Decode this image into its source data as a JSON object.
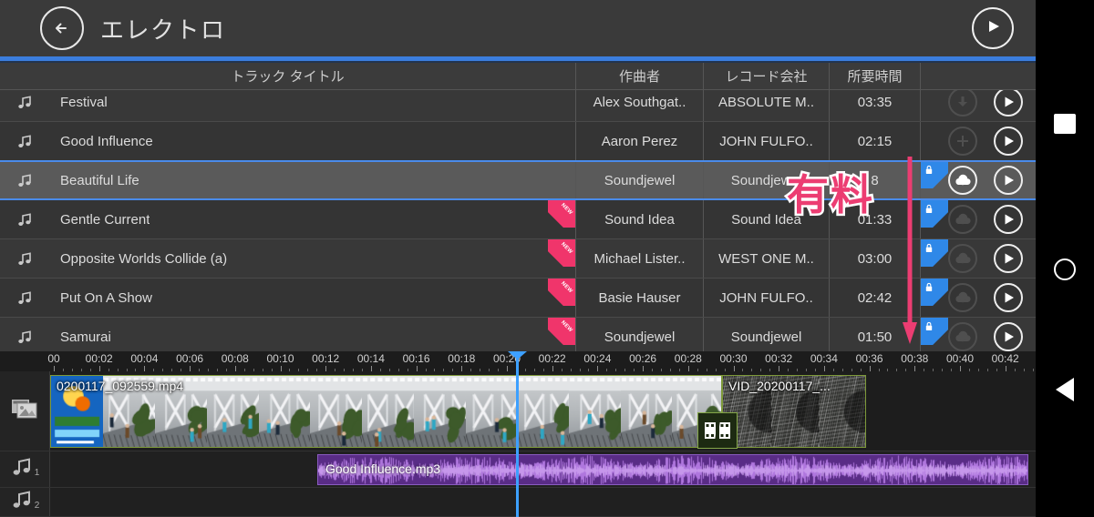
{
  "app": {
    "title": "エレクトロ",
    "back_icon": "back-arrow-icon",
    "play_icon": "play-icon"
  },
  "table": {
    "headers": {
      "track_title": "トラック タイトル",
      "composer": "作曲者",
      "label": "レコード会社",
      "duration": "所要時間",
      "actions": ""
    },
    "rows": [
      {
        "title": "Festival",
        "composer": "Alex Southgat..",
        "label": "ABSOLUTE M..",
        "duration": "03:35",
        "new": false,
        "locked": false,
        "selected": false,
        "action": "download-icon"
      },
      {
        "title": "Good Influence",
        "composer": "Aaron Perez",
        "label": "JOHN FULFO..",
        "duration": "02:15",
        "new": false,
        "locked": false,
        "selected": false,
        "action": "plus-icon"
      },
      {
        "title": "Beautiful Life",
        "composer": "Soundjewel",
        "label": "Soundjewel",
        "duration": "8",
        "new": false,
        "locked": true,
        "selected": true,
        "action": "cloud-download-icon"
      },
      {
        "title": "Gentle Current",
        "composer": "Sound Idea",
        "label": "Sound Idea",
        "duration": "01:33",
        "new": true,
        "locked": true,
        "selected": false,
        "action": "cloud-download-icon"
      },
      {
        "title": "Opposite Worlds Collide (a)",
        "composer": "Michael Lister..",
        "label": "WEST ONE M..",
        "duration": "03:00",
        "new": true,
        "locked": true,
        "selected": false,
        "action": "cloud-download-icon"
      },
      {
        "title": "Put On A Show",
        "composer": "Basie Hauser",
        "label": "JOHN FULFO..",
        "duration": "02:42",
        "new": true,
        "locked": true,
        "selected": false,
        "action": "cloud-download-icon"
      },
      {
        "title": "Samurai",
        "composer": "Soundjewel",
        "label": "Soundjewel",
        "duration": "01:50",
        "new": true,
        "locked": true,
        "selected": false,
        "action": "cloud-download-icon"
      }
    ],
    "badge_new_label": "NEW"
  },
  "timeline": {
    "ruler_labels": [
      "00",
      "00:02",
      "00:04",
      "00:06",
      "00:08",
      "00:10",
      "00:12",
      "00:14",
      "00:16",
      "00:18",
      "00:20",
      "00:22",
      "00:24",
      "00:26",
      "00:28",
      "00:30",
      "00:32",
      "00:34",
      "00:36",
      "00:38",
      "00:40",
      "00:42"
    ],
    "playhead_time": "00:20",
    "video_track": {
      "icon": "image-clip-icon",
      "clips": [
        {
          "name": "0200117_092559.mp4"
        },
        {
          "name": "VID_20200117_..."
        }
      ],
      "transition_icon": "transition-icon"
    },
    "audio_tracks": [
      {
        "icon": "music-note-icon",
        "index": "1",
        "clip": "Good Influence.mp3"
      },
      {
        "icon": "music-note-icon",
        "index": "2",
        "clip": ""
      }
    ]
  },
  "annotations": {
    "paid_label": "有料",
    "arrow": "down-arrow-annotation"
  },
  "navbar": {
    "recents": "recents-square-icon",
    "home": "home-circle-icon",
    "back": "back-triangle-icon"
  },
  "colors": {
    "accent_blue": "#3b7ddd",
    "selection_blue": "#4a8bea",
    "annotation_pink": "#ec3d72",
    "new_badge": "#f0356b",
    "lock_badge": "#2f88e8",
    "audio_clip": "#5a2d86"
  }
}
